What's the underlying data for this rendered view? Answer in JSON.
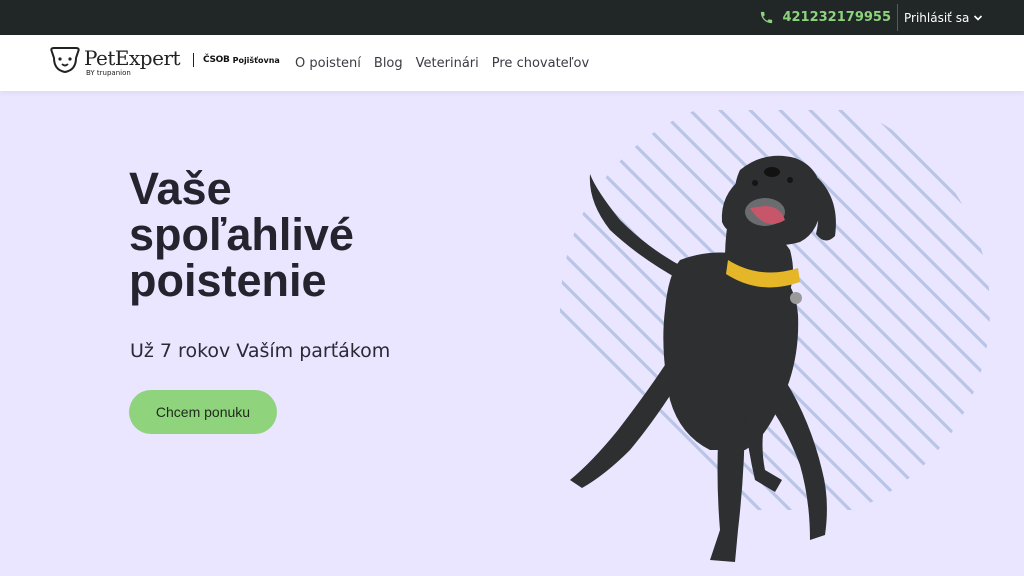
{
  "topbar": {
    "phone": "421232179955",
    "login_label": "Prihlásiť sa",
    "phone_icon": "phone-icon",
    "chevron_icon": "chevron-down-icon"
  },
  "navbar": {
    "logo": {
      "brand": "PetExpert",
      "by": "BY trupanion",
      "partner_mark": "ČSOB",
      "partner_name": "Pojišťovna"
    },
    "links": [
      "O poistení",
      "Blog",
      "Veterinári",
      "Pre chovateľov"
    ]
  },
  "hero": {
    "title": [
      "Vaše",
      "spoľahlivé",
      "poistenie"
    ],
    "subtitle": "Už 7 rokov Vaším parťákom",
    "cta_label": "Chcem ponuku"
  },
  "colors": {
    "topbar_bg": "#212627",
    "accent_green": "#8fd37d",
    "hero_bg": "#ebe6ff",
    "stripe_color": "#b9c4e6"
  }
}
